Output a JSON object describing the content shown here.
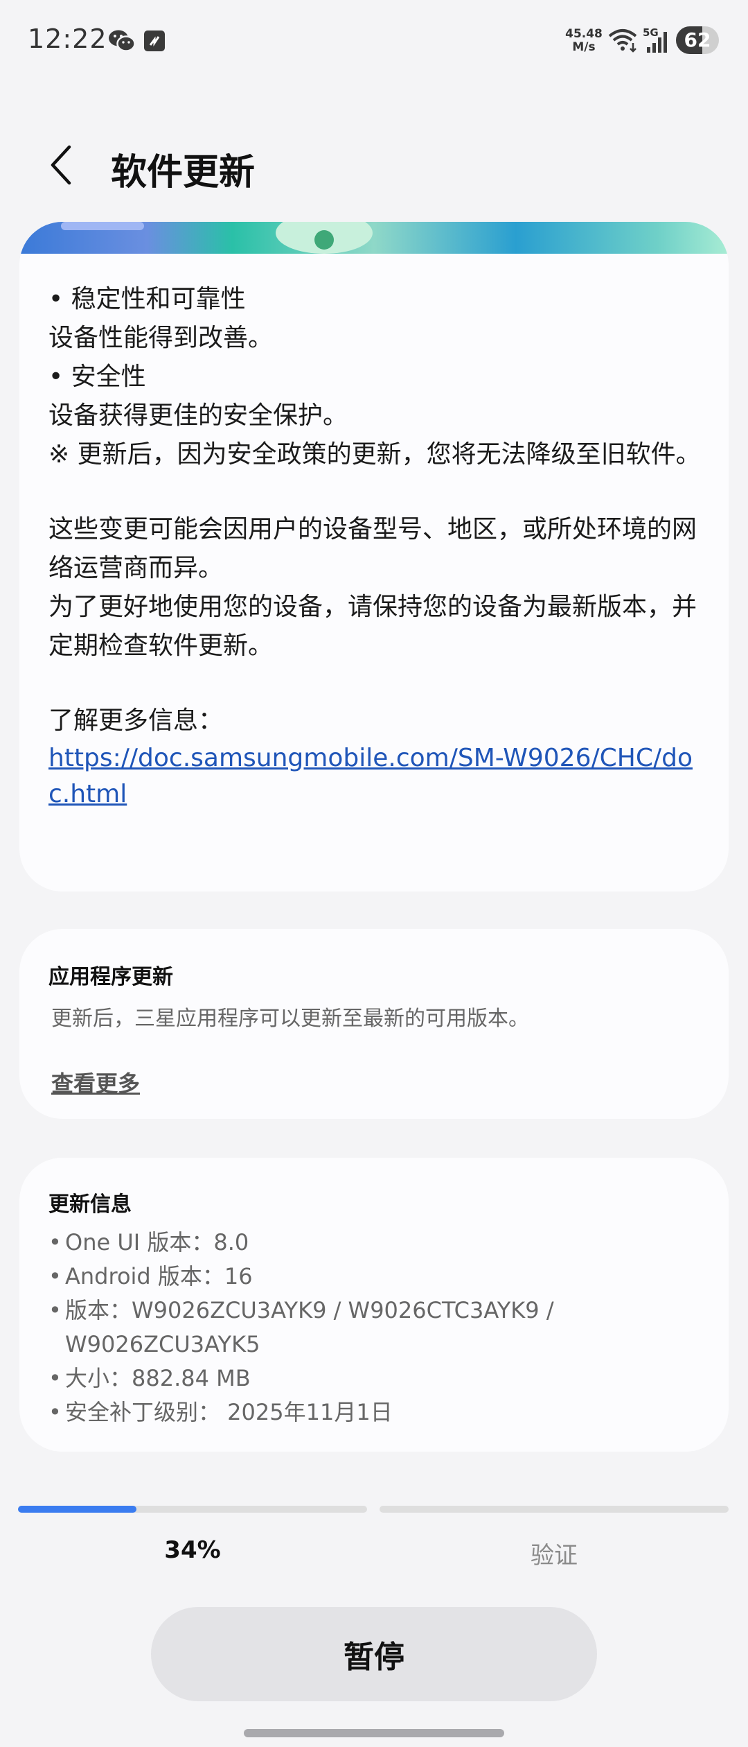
{
  "status_bar": {
    "time": "12:22",
    "net_speed_value": "45.48",
    "net_speed_unit": "M/s",
    "network_type": "5G",
    "battery_level": "62",
    "battery_fraction": 0.62,
    "icons": [
      "wechat-icon",
      "app-notification-icon",
      "wifi-icon",
      "signal-icon",
      "battery-icon"
    ]
  },
  "header": {
    "title": "软件更新",
    "back_icon": "chevron-left-icon"
  },
  "release_notes": {
    "lines": [
      "• 稳定性和可靠性",
      "设备性能得到改善。",
      "• 安全性",
      "设备获得更佳的安全保护。",
      "※ 更新后，因为安全政策的更新，您将无法降级至旧软件。",
      "这些变更可能会因用户的设备型号、地区，或所处环境的网络运营商而异。",
      "为了更好地使用您的设备，请保持您的设备为最新版本，并定期检查软件更新。",
      "了解更多信息："
    ],
    "link": "https://doc.samsungmobile.com/SM-W9026/CHC/doc.html"
  },
  "app_updates": {
    "heading": "应用程序更新",
    "description": "更新后，三星应用程序可以更新至最新的可用版本。",
    "see_more": "查看更多"
  },
  "update_info": {
    "heading": "更新信息",
    "bullet": "•",
    "one_ui": "One UI 版本：8.0",
    "android": "Android 版本：16",
    "version_line1": "版本：W9026ZCU3AYK9 / W9026CTC3AYK9 /",
    "version_line2": "W9026ZCU3AYK5",
    "size": "大小：882.84 MB",
    "security_patch": "安全补丁级别： 2025年11月1日"
  },
  "progress": {
    "download_percent": 34,
    "download_label": "34%",
    "verify_label": "验证",
    "verify_percent": 0,
    "accent": "#3a7cf0"
  },
  "actions": {
    "pause_label": "暂停"
  }
}
